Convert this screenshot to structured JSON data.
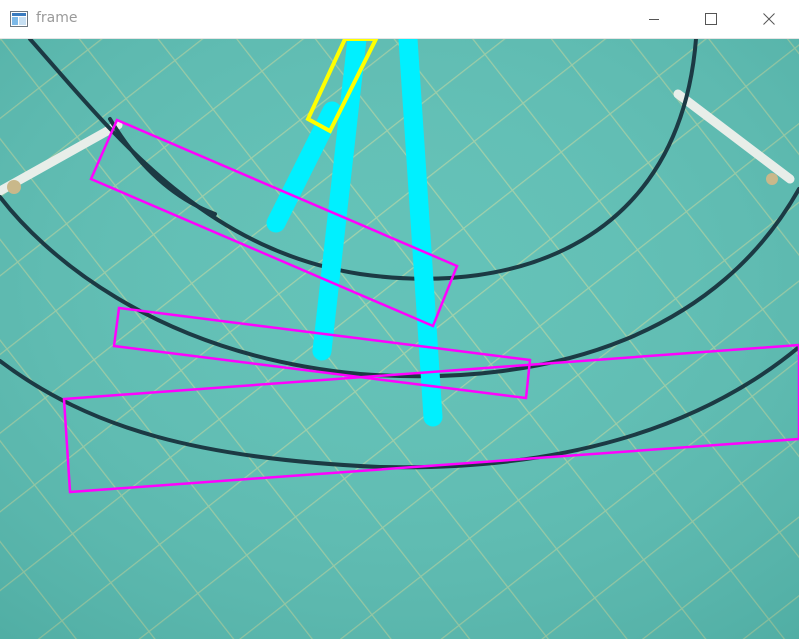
{
  "window": {
    "title": "frame",
    "icons": {
      "app": "image-window-icon",
      "minimize": "minimize-icon",
      "maximize": "maximize-icon",
      "close": "close-icon"
    }
  },
  "frame": {
    "scene": "underwater-pool-tiles",
    "colors": {
      "water": "#5bbfb4",
      "tile_grout": "#9ccfa7",
      "hose": "#1c3a44",
      "cyan_overlay": "#00f0ff",
      "yellow_overlay": "#ffff00",
      "magenta_overlay": "#ff00ff"
    }
  }
}
